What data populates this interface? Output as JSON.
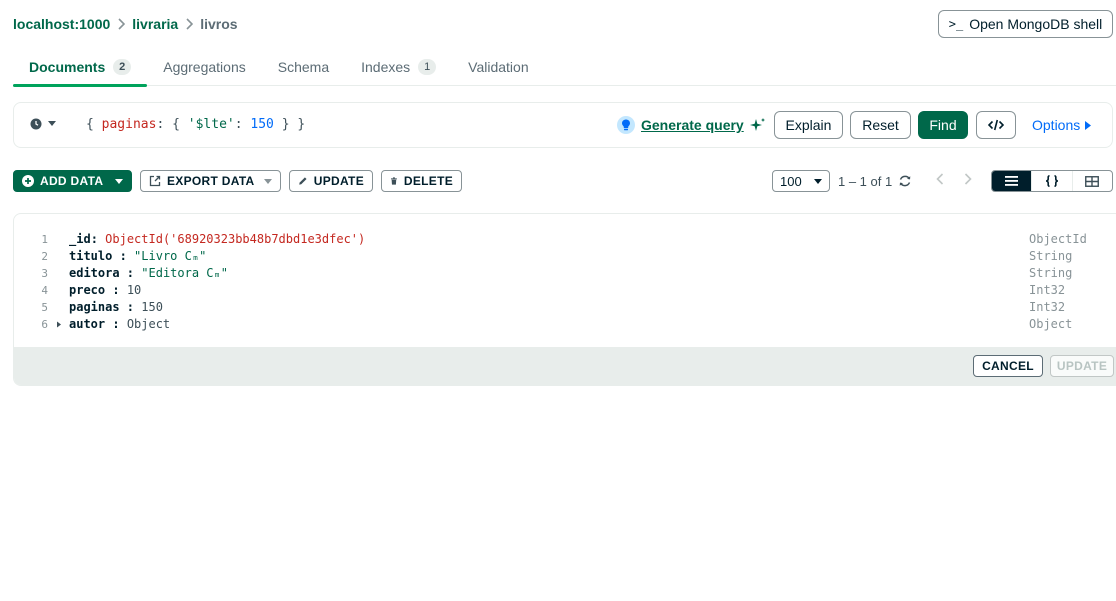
{
  "breadcrumb": {
    "host": "localhost:1000",
    "database": "livraria",
    "collection": "livros"
  },
  "shell_button": {
    "prompt": ">_",
    "label": "Open MongoDB shell"
  },
  "tabs": [
    {
      "label": "Documents",
      "count": "2",
      "active": true
    },
    {
      "label": "Aggregations"
    },
    {
      "label": "Schema"
    },
    {
      "label": "Indexes",
      "count": "1"
    },
    {
      "label": "Validation"
    }
  ],
  "query_bar": {
    "open": "{",
    "field": "paginas",
    "colon": ":",
    "inner_open": "{",
    "operator": "'$lte'",
    "value": "150",
    "inner_close": "}",
    "close": "}",
    "generate_label": "Generate query",
    "explain_label": "Explain",
    "reset_label": "Reset",
    "find_label": "Find",
    "options_label": "Options"
  },
  "toolbar": {
    "add_data": "ADD DATA",
    "export_data": "EXPORT DATA",
    "update": "UPDATE",
    "delete": "DELETE",
    "page_size": "100",
    "range": "1 – 1 of 1"
  },
  "document": {
    "fields": [
      {
        "line": "1",
        "key": "_id",
        "sep": ":",
        "value": "ObjectId('68920323bb48b7dbd1e3dfec')",
        "type": "ObjectId",
        "kind": "oid"
      },
      {
        "line": "2",
        "key": "titulo",
        "sep": " :",
        "value": "\"Livro Cₘ\"",
        "type": "String",
        "kind": "str"
      },
      {
        "line": "3",
        "key": "editora",
        "sep": " :",
        "value": "\"Editora Cₘ\"",
        "type": "String",
        "kind": "str"
      },
      {
        "line": "4",
        "key": "preco",
        "sep": " :",
        "value": "10",
        "type": "Int32",
        "kind": "num"
      },
      {
        "line": "5",
        "key": "paginas",
        "sep": " :",
        "value": "150",
        "type": "Int32",
        "kind": "num"
      },
      {
        "line": "6",
        "key": "autor",
        "sep": " :",
        "value": "Object",
        "type": "Object",
        "kind": "obj",
        "expandable": true
      }
    ],
    "cancel_label": "CANCEL",
    "update_label": "UPDATE"
  }
}
